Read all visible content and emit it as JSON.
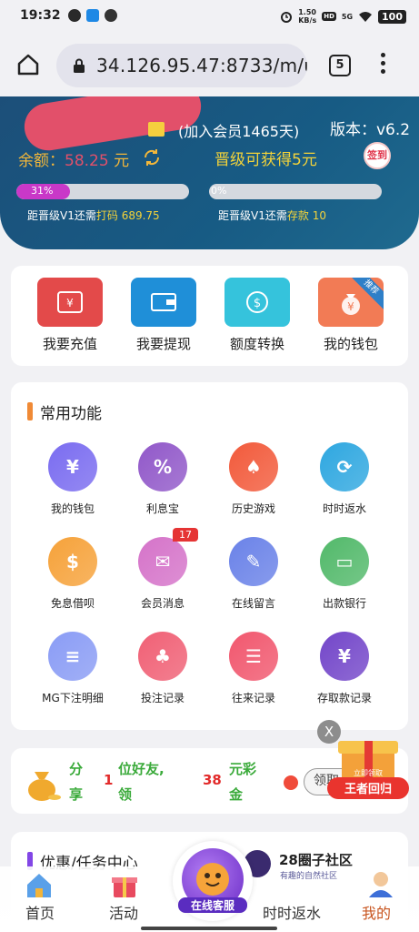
{
  "status_bar": {
    "time": "19:32",
    "net_speed": "1.50\nKB/s",
    "net_badges": [
      "HD",
      "5G"
    ],
    "battery": "100"
  },
  "browser": {
    "url": "34.126.95.47:8733/m/u",
    "tab_count": "5"
  },
  "header": {
    "member_days": "(加入会员1465天)",
    "version": "版本：v6.2",
    "balance_label": "余额：",
    "balance_value": "58.25",
    "balance_unit": " 元",
    "upgrade_text": "晋级可获得5元",
    "signin_label": "签到",
    "progress_bet": {
      "percent_label": "31%",
      "fraction": 0.31,
      "need_prefix": "距晋级V1还需",
      "need_kind": "打码",
      "need_value": "689.75"
    },
    "progress_deposit": {
      "percent_label": "0%",
      "fraction": 0.0,
      "need_prefix": "距晋级V1还需",
      "need_kind": "存款",
      "need_value": "10"
    }
  },
  "quick_actions": [
    {
      "label": "我要充值",
      "icon": "recharge-icon",
      "color": "#e34a4a"
    },
    {
      "label": "我要提现",
      "icon": "withdraw-icon",
      "color": "#1f8fd8"
    },
    {
      "label": "额度转换",
      "icon": "transfer-icon",
      "color": "#35c3dc"
    },
    {
      "label": "我的钱包",
      "icon": "wallet-bag-icon",
      "color": "#f27b55",
      "ribbon": "推荐"
    }
  ],
  "common_functions": {
    "title": "常用功能",
    "items": [
      {
        "label": "我的钱包",
        "icon": "wallet-icon",
        "color": "#7a6cf0"
      },
      {
        "label": "利息宝",
        "icon": "interest-bag-icon",
        "color": "#9158c9"
      },
      {
        "label": "历史游戏",
        "icon": "cards-icon",
        "color": "#f25a3b"
      },
      {
        "label": "时时返水",
        "icon": "rebate-icon",
        "color": "#2ea7e0"
      },
      {
        "label": "免息借呗",
        "icon": "loan-icon",
        "color": "#f6a23a"
      },
      {
        "label": "会员消息",
        "icon": "mail-icon",
        "color": "#d573c9",
        "badge": "17"
      },
      {
        "label": "在线留言",
        "icon": "edit-note-icon",
        "color": "#6a82e8"
      },
      {
        "label": "出款银行",
        "icon": "bank-card-icon",
        "color": "#52b96a"
      },
      {
        "label": "MG下注明细",
        "icon": "bet-detail-icon",
        "color": "#8a9cf5"
      },
      {
        "label": "投注记录",
        "icon": "bet-cards-icon",
        "color": "#f06075"
      },
      {
        "label": "往来记录",
        "icon": "record-icon",
        "color": "#f1576e"
      },
      {
        "label": "存取款记录",
        "icon": "deposit-record-icon",
        "color": "#7346c9"
      }
    ]
  },
  "invite": {
    "t1a": "分",
    "t1b": "享",
    "t2": "1",
    "t3a": "位好友,",
    "t3b": "领",
    "t4": "38",
    "t5a": "元彩",
    "t5b": "金",
    "receive": "领取"
  },
  "gift_float": {
    "close": "X",
    "banner": "王者回归",
    "tag": "立即领取"
  },
  "promo": {
    "title": "优惠/任务中心"
  },
  "community": {
    "title": "28圈子社区",
    "subtitle": "有趣的自然社区"
  },
  "tabbar": {
    "home": "首页",
    "activity": "活动",
    "service": "在线客服",
    "rebate": "时时返水",
    "mine": "我的"
  },
  "colors": {
    "header_bg": "#1b5780",
    "accent_yellow": "#f3d33a",
    "balance_red": "#e2506a",
    "progress_fill": "#c938c8"
  }
}
